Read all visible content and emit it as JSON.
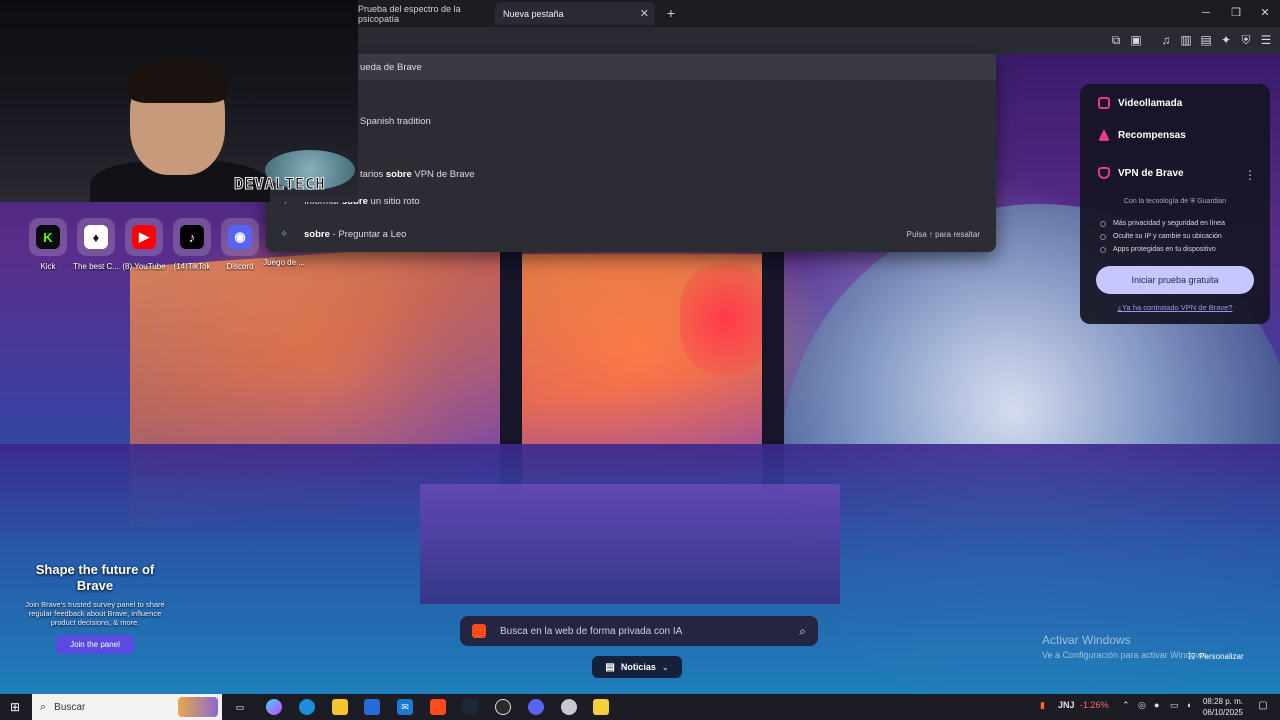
{
  "browser": {
    "tabs": [
      {
        "title": "Prueba del espectro de la psicopatía",
        "active": false
      },
      {
        "title": "Nueva pestaña",
        "active": true
      }
    ],
    "new_tab_glyph": "+",
    "window_controls": {
      "minimize": "─",
      "maximize": "❐",
      "close": "✕"
    },
    "toolbar_icons": [
      "extensions-icon",
      "reading-list-icon",
      "music-icon",
      "sidebar-icon",
      "wallet-icon",
      "leo-icon",
      "shield-icon",
      "menu-icon"
    ]
  },
  "omnibox_dropdown": {
    "rows": [
      {
        "pre": "",
        "bold": "",
        "post": "ueda de Brave",
        "highlighted": true
      },
      {
        "pre": "",
        "bold": "",
        "post": "Spanish tradition",
        "highlighted": false
      },
      {
        "pre": "tarios ",
        "bold": "sobre",
        "post": " VPN de Brave",
        "highlighted": false
      },
      {
        "pre": "Informar ",
        "bold": "sobre",
        "post": " un sitio roto",
        "highlighted": false
      },
      {
        "pre": "",
        "bold": "sobre",
        "post": " - Preguntar a Leo",
        "highlighted": false
      }
    ],
    "hint": "Pulsa ↑ para resaltar"
  },
  "webcam": {
    "watermark": "DEVALTECH"
  },
  "shortcuts": [
    {
      "label": "Kick",
      "glyph": "K",
      "bg": "#0a0a0a",
      "fg": "#53fc18"
    },
    {
      "label": "The best C...",
      "glyph": "♦",
      "bg": "#ffffff",
      "fg": "#1a1a1a"
    },
    {
      "label": "(8) YouTube",
      "glyph": "▶",
      "bg": "#ff0000",
      "fg": "#ffffff"
    },
    {
      "label": "(14)TikTok",
      "glyph": "♪",
      "bg": "#000000",
      "fg": "#ffffff"
    },
    {
      "label": "Discord",
      "glyph": "◉",
      "bg": "#5865f2",
      "fg": "#ffffff"
    },
    {
      "label": "Juego de ...",
      "glyph": "",
      "bg": "rgba(255,255,255,0)",
      "fg": "#ffffff"
    }
  ],
  "side_panel": {
    "videocall": "Videollamada",
    "rewards": "Recompensas",
    "vpn_title": "VPN de Brave",
    "vpn_powered": "Con la tecnología de ⛨ Guardian",
    "benefits": [
      "Más privacidad y seguridad en línea",
      "Oculte su IP y cambie su ubicación",
      "Apps protegidas en tu dispositivo"
    ],
    "cta": "Iniciar prueba gratuita",
    "link": "¿Ya ha contratado VPN de Brave?",
    "colors": {
      "accent": "#c8c6ff",
      "icon": "#e83a8a"
    }
  },
  "promo": {
    "title": "Shape the future of Brave",
    "body": "Join Brave's trusted survey panel to share regular feedback about Brave, influence product decisions, & more.",
    "button": "Join the panel"
  },
  "search": {
    "placeholder": "Busca en la web de forma privada con IA"
  },
  "news": {
    "label": "Noticias"
  },
  "windows_activation": {
    "title": "Activar Windows",
    "subtitle": "Ve a Configuración para activar Windows."
  },
  "customize": {
    "label": "Personalizar"
  },
  "taskbar": {
    "search_placeholder": "Buscar",
    "apps": [
      "task-view",
      "copilot",
      "edge",
      "file-explorer",
      "store",
      "mail",
      "brave",
      "steam",
      "obs",
      "discord",
      "app",
      "app-yellow"
    ],
    "stock": {
      "ticker": "JNJ",
      "change": "-1.26%"
    },
    "time": "08:28 p. m.",
    "date": "06/10/2025"
  }
}
